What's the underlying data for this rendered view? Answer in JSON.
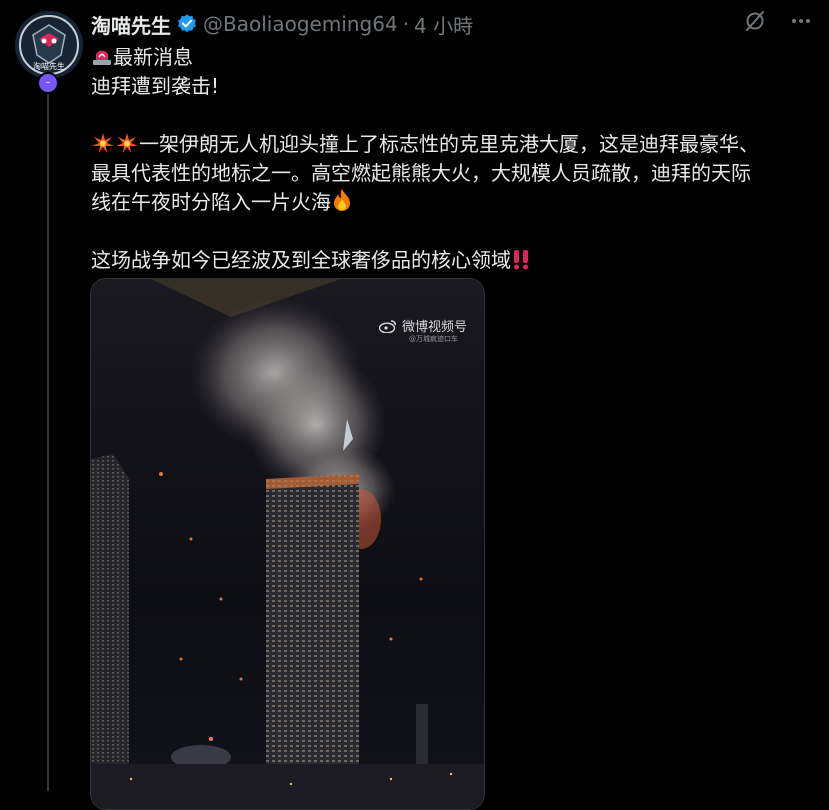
{
  "post": {
    "display_name": "淘喵先生",
    "handle": "@Baoliaogeming64",
    "separator": "·",
    "time_ago": "4 小時",
    "avatar_text": "淘喵先生",
    "avatar_badge": "–",
    "lines": {
      "heading": "最新消息",
      "headline": "迪拜遭到袭击!",
      "body_1": "一架伊朗无人机迎头撞上了标志性的克里克港大厦，这是迪拜最豪华、",
      "body_2": "最具代表性的地标之一。高空燃起熊熊大火，大规模人员疏散，迪拜的天际",
      "body_3": "线在午夜时分陷入一片火海",
      "closing": "这场战争如今已经波及到全球奢侈品的核心领域"
    }
  },
  "media": {
    "watermark": "微博视频号",
    "watermark_sub": "@万城疯迹口车"
  },
  "icons": {
    "verified": "verified-badge-icon",
    "grok": "grok-icon",
    "more": "more-icon",
    "siren": "siren-emoji-icon",
    "collision": "collision-emoji-icon",
    "fire": "fire-emoji-icon",
    "double_exclamation": "double-exclamation-emoji-icon"
  },
  "colors": {
    "background": "#000000",
    "text": "#e7e9ea",
    "muted": "#71767b",
    "verified": "#1d9bf0",
    "badge": "#7856ff",
    "alert_red": "#e0245e"
  }
}
